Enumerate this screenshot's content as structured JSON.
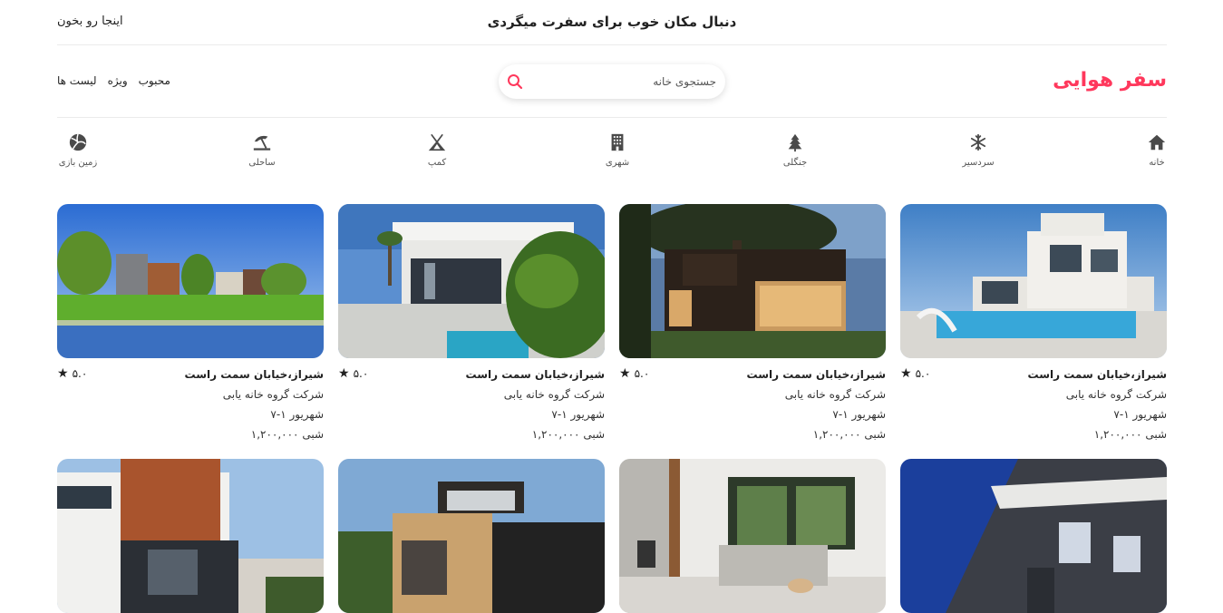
{
  "topbar": {
    "title": "دنبال مکان خوب برای سفرت میگردی",
    "read_here": "اینجا رو بخون"
  },
  "header": {
    "brand": "سفر هوایی",
    "search_placeholder": "جستجوی خانه",
    "nav": [
      "لیست ها",
      "ویژه",
      "محبوب"
    ],
    "accent_color": "#ff385c"
  },
  "categories": [
    {
      "label": "خانه",
      "icon": "home-icon"
    },
    {
      "label": "سردسیر",
      "icon": "snowflake-icon"
    },
    {
      "label": "جنگلی",
      "icon": "tree-icon"
    },
    {
      "label": "شهری",
      "icon": "building-icon"
    },
    {
      "label": "کمپ",
      "icon": "tent-icon"
    },
    {
      "label": "ساحلی",
      "icon": "umbrella-beach-icon"
    },
    {
      "label": "زمین بازی",
      "icon": "volleyball-icon"
    }
  ],
  "listings": [
    {
      "location": "شیراز،خیابان سمت راست",
      "company": "شرکت گروه خانه یابی",
      "dates": "شهریور ۱-۷",
      "price": "شبی ۱,۲۰۰,۰۰۰",
      "rating": "۵.۰"
    },
    {
      "location": "شیراز،خیابان سمت راست",
      "company": "شرکت گروه خانه یابی",
      "dates": "شهریور ۱-۷",
      "price": "شبی ۱,۲۰۰,۰۰۰",
      "rating": "۵.۰"
    },
    {
      "location": "شیراز،خیابان سمت راست",
      "company": "شرکت گروه خانه یابی",
      "dates": "شهریور ۱-۷",
      "price": "شبی ۱,۲۰۰,۰۰۰",
      "rating": "۵.۰"
    },
    {
      "location": "شیراز،خیابان سمت راست",
      "company": "شرکت گروه خانه یابی",
      "dates": "شهریور ۱-۷",
      "price": "شبی ۱,۲۰۰,۰۰۰",
      "rating": "۵.۰"
    }
  ]
}
